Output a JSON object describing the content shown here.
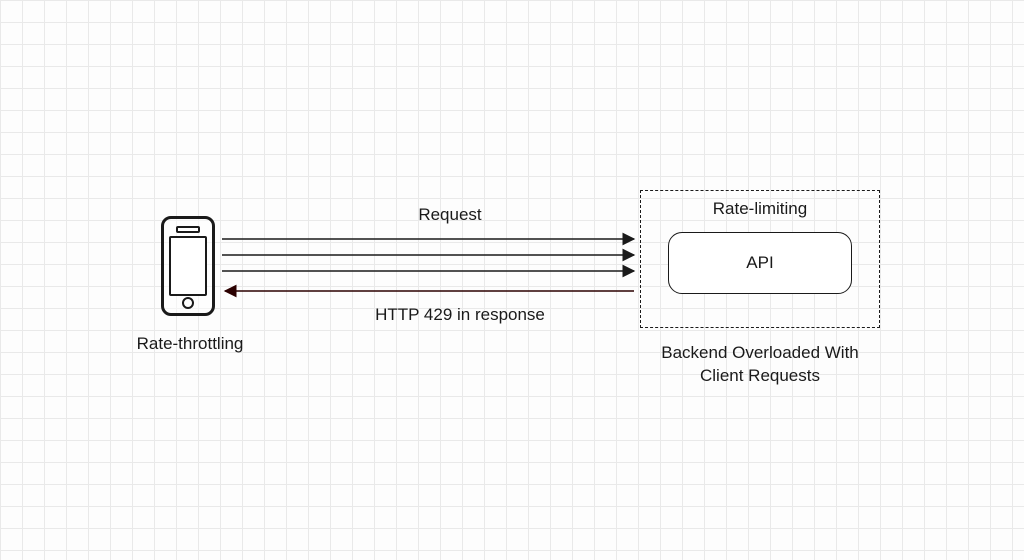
{
  "diagram": {
    "client_label": "Rate-throttling",
    "request_label": "Request",
    "response_label": "HTTP 429 in response",
    "server_box_title": "Rate-limiting",
    "api_label": "API",
    "server_caption": "Backend Overloaded With Client Requests"
  }
}
